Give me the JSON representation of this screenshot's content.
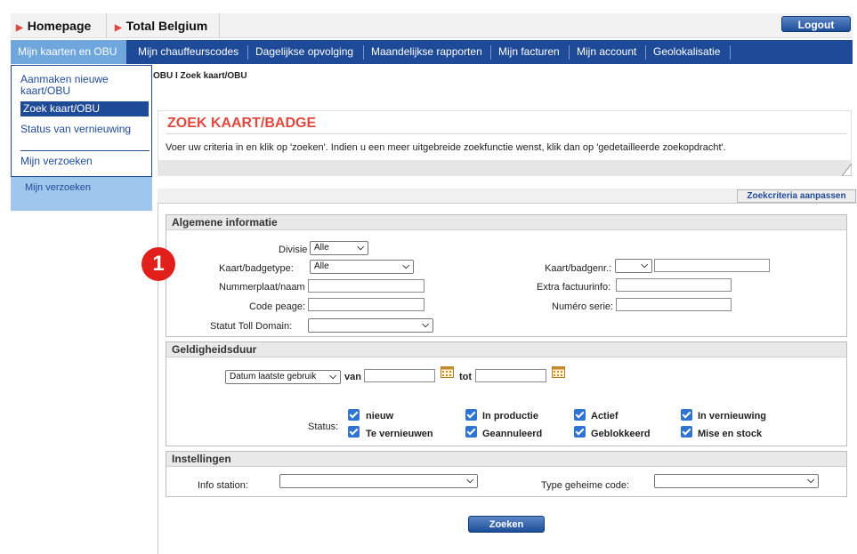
{
  "topbar": {
    "homepage": "Homepage",
    "company": "Total Belgium",
    "logout": "Logout"
  },
  "nav": {
    "items": [
      "Mijn kaarten en OBU",
      "Mijn chauffeurscodes",
      "Dagelijkse opvolging",
      "Maandelijkse rapporten",
      "Mijn facturen",
      "Mijn account",
      "Geolokalisatie"
    ]
  },
  "dropdown": {
    "items": [
      "Aanmaken nieuwe kaart/OBU",
      "Zoek kaart/OBU",
      "Status van vernieuwing",
      "Mijn verzoeken"
    ]
  },
  "left_panel": {
    "item": "Mijn verzoeken"
  },
  "breadcrumb": "OBU I Zoek kaart/OBU",
  "header": {
    "title": "ZOEK KAART/BADGE",
    "description": "Voer uw criteria in en klik op 'zoeken'. Indien u een meer uitgebreide zoekfunctie wenst, klik dan op 'gedetailleerde zoekopdracht'."
  },
  "adjust_button": "Zoekcriteria aanpassen",
  "general": {
    "legend": "Algemene informatie",
    "divisie_label": "Divisie",
    "divisie_value": "Alle",
    "type_label": "Kaart/badgetype:",
    "type_value": "Alle",
    "plate_label": "Nummerplaat/naam",
    "code_label": "Code peage:",
    "statut_label": "Statut Toll Domain:",
    "cardnr_label": "Kaart/badgenr.:",
    "extra_label": "Extra factuurinfo:",
    "serie_label": "Numéro serie:"
  },
  "validity": {
    "legend": "Geldigheidsduur",
    "date_type": "Datum laatste gebruik",
    "from_label": "van",
    "to_label": "tot",
    "status_label": "Status:",
    "statuses": [
      "nieuw",
      "In productie",
      "Actief",
      "In vernieuwing",
      "Te vernieuwen",
      "Geannuleerd",
      "Geblokkeerd",
      "Mise en stock"
    ]
  },
  "settings": {
    "legend": "Instellingen",
    "info_label": "Info station:",
    "secret_label": "Type geheime code:"
  },
  "search_button": "Zoeken",
  "marker": "1",
  "colors": {
    "nav_blue": "#1e4a97",
    "active_tab": "#6fa7dc",
    "title_red": "#e1483e",
    "checkbox_blue": "#2f74d0",
    "marker_red": "#e1201b"
  }
}
